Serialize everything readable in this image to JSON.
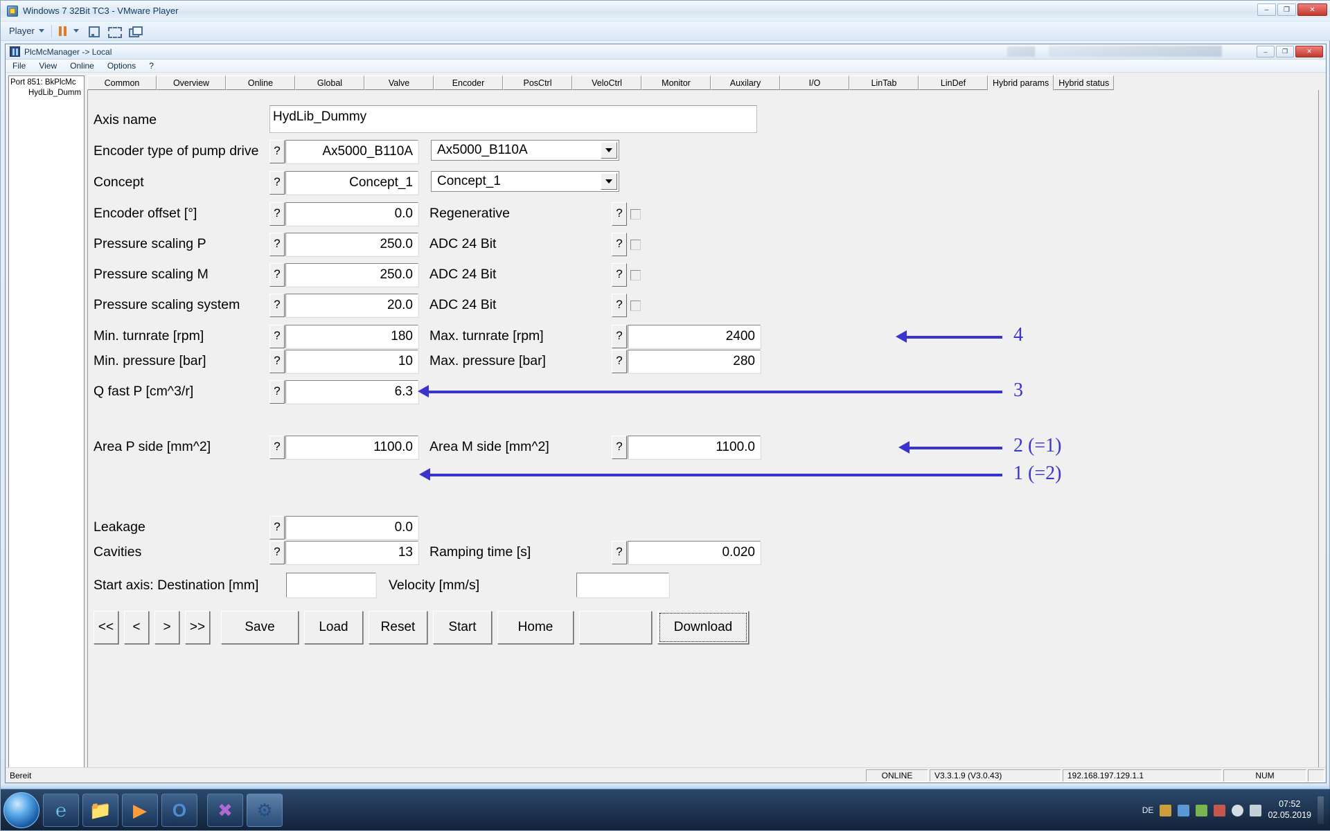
{
  "vmware": {
    "title": "Windows 7 32Bit TC3 - VMware Player",
    "menu_player": "Player",
    "win_min": "–",
    "win_max": "❐",
    "win_close": "✕"
  },
  "app": {
    "title": "PlcMcManager -> Local",
    "menu": [
      "File",
      "View",
      "Online",
      "Options",
      "?"
    ],
    "win_min": "–",
    "win_max": "❐",
    "win_close": "✕"
  },
  "tree": {
    "root": "Port 851: BkPlcMc",
    "child": "HydLib_Dumm",
    "scroll_glyph": "III"
  },
  "tabs": [
    {
      "label": "Common",
      "active": false
    },
    {
      "label": "Overview",
      "active": false
    },
    {
      "label": "Online",
      "active": false
    },
    {
      "label": "Global",
      "active": false
    },
    {
      "label": "Valve",
      "active": false
    },
    {
      "label": "Encoder",
      "active": false
    },
    {
      "label": "PosCtrl",
      "active": false
    },
    {
      "label": "VeloCtrl",
      "active": false
    },
    {
      "label": "Monitor",
      "active": false
    },
    {
      "label": "Auxilary",
      "active": false
    },
    {
      "label": "I/O",
      "active": false
    },
    {
      "label": "LinTab",
      "active": false
    },
    {
      "label": "LinDef",
      "active": false
    },
    {
      "label": "Hybrid params",
      "active": true
    },
    {
      "label": "Hybrid status",
      "active": false
    }
  ],
  "form": {
    "help_glyph": "?",
    "axis_name_label": "Axis name",
    "axis_name_value": "HydLib_Dummy",
    "encoder_type_label": "Encoder type of pump drive",
    "encoder_type_value": "Ax5000_B110A",
    "encoder_type_combo": "Ax5000_B110A",
    "concept_label": "Concept",
    "concept_value": "Concept_1",
    "concept_combo": "Concept_1",
    "encoder_offset_label": "Encoder offset [°]",
    "encoder_offset_value": "0.0",
    "regenerative_label": "Regenerative",
    "pressure_scaling_p_label": "Pressure scaling P",
    "pressure_scaling_p_value": "250.0",
    "adc_24_bit_1_label": "ADC 24 Bit",
    "pressure_scaling_m_label": "Pressure scaling M",
    "pressure_scaling_m_value": "250.0",
    "adc_24_bit_2_label": "ADC 24 Bit",
    "pressure_scaling_system_label": "Pressure scaling system",
    "pressure_scaling_system_value": "20.0",
    "adc_24_bit_3_label": "ADC 24 Bit",
    "min_turnrate_label": "Min. turnrate [rpm]",
    "min_turnrate_value": "180",
    "max_turnrate_label": "Max. turnrate [rpm]",
    "max_turnrate_value": "2400",
    "min_pressure_label": "Min. pressure [bar]",
    "min_pressure_value": "10",
    "max_pressure_label": "Max. pressure [bar]",
    "max_pressure_value": "280",
    "q_fast_p_label": "Q fast P [cm^3/r]",
    "q_fast_p_value": "6.3",
    "area_p_label": "Area P side [mm^2]",
    "area_p_value": "1100.0",
    "area_m_label": "Area M side [mm^2]",
    "area_m_value": "1100.0",
    "leakage_label": "Leakage",
    "leakage_value": "0.0",
    "cavities_label": "Cavities",
    "cavities_value": "13",
    "ramping_time_label": "Ramping time [s]",
    "ramping_time_value": "0.020",
    "start_axis_label": "Start axis: Destination [mm]",
    "start_axis_value": "",
    "velocity_label": "Velocity [mm/s]",
    "velocity_value": ""
  },
  "buttons": {
    "first": "<<",
    "prev": "<",
    "next": ">",
    "last": ">>",
    "save": "Save",
    "load": "Load",
    "reset": "Reset",
    "start": "Start",
    "home": "Home",
    "blank": "",
    "download": "Download"
  },
  "annotations": {
    "accent_color": "#3a33cc",
    "items": [
      {
        "label": "4"
      },
      {
        "label": "3"
      },
      {
        "label": "2 (=1)"
      },
      {
        "label": "1 (=2)"
      }
    ]
  },
  "status": {
    "ready": "Bereit",
    "online": "ONLINE",
    "version": "V3.3.1.9 (V3.0.43)",
    "ip": "192.168.197.129.1.1",
    "num": "NUM"
  },
  "taskbar": {
    "lang": "DE",
    "time": "07:52",
    "date": "02.05.2019",
    "items": [
      {
        "name": "internet-explorer",
        "glyph": "℮"
      },
      {
        "name": "windows-explorer",
        "glyph": "📁"
      },
      {
        "name": "media-player",
        "glyph": "▶"
      },
      {
        "name": "outlook",
        "glyph": "O"
      },
      {
        "name": "visual-studio",
        "glyph": "✖"
      },
      {
        "name": "twincat",
        "glyph": "⚙"
      }
    ]
  }
}
